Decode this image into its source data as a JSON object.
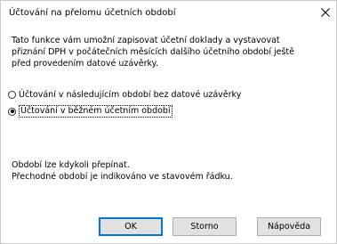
{
  "window": {
    "title": "Účtování na přelomu účetních období"
  },
  "icons": {
    "close": "close-icon"
  },
  "description": {
    "line1": "Tato funkce vám umožní zapisovat účetní doklady a vystavovat",
    "line2": "přiznání DPH v počátečních měsících dalšího účetního období ještě",
    "line3": "před provedením datové uzávěrky."
  },
  "options": [
    {
      "label": "Účtování v následujícím období bez datové uzávěrky",
      "checked": false
    },
    {
      "label": "Účtování v běžném účetním období",
      "checked": true
    }
  ],
  "note": {
    "line1": "Období lze kdykoli přepínat.",
    "line2": "Přechodné období je indikováno ve stavovém řádku."
  },
  "buttons": {
    "ok": "OK",
    "cancel": "Storno",
    "help": "Nápověda"
  },
  "colors": {
    "default_button_border": "#0078d7",
    "button_background": "#e1e1e1",
    "window_border": "#c9c9c9"
  }
}
